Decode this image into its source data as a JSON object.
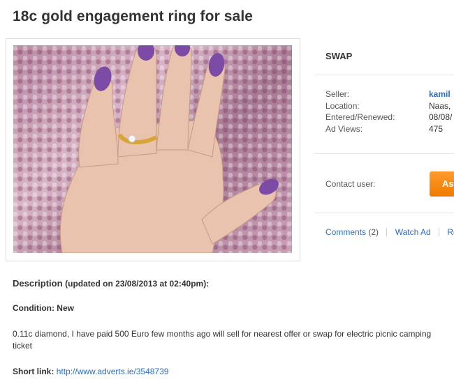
{
  "ad": {
    "title": "18c gold engagement ring for sale",
    "type_label": "SWAP"
  },
  "details": {
    "seller_label": "Seller:",
    "seller_value": "kamil",
    "location_label": "Location:",
    "location_value": "Naas,",
    "entered_label": "Entered/Renewed:",
    "entered_value": "08/08/",
    "views_label": "Ad Views:",
    "views_value": "475"
  },
  "contact": {
    "label": "Contact user:",
    "button_label": "As"
  },
  "actions": {
    "comments_label": "Comments",
    "comments_count": "(2)",
    "watch_label": "Watch Ad",
    "report_label": "Rep"
  },
  "description": {
    "heading": "Description",
    "updated": "(updated on 23/08/2013 at 02:40pm):",
    "condition": "Condition: New",
    "text": "0.11c diamond, I have paid 500 Euro few months ago will sell for nearest offer or swap for electric picnic camping ticket",
    "short_link_label": "Short link:",
    "short_link_url": "http://www.adverts.ie/3548739"
  },
  "colors": {
    "link": "#2a6cc4",
    "button": "#f07b00",
    "nail": "#7b4ba6"
  }
}
